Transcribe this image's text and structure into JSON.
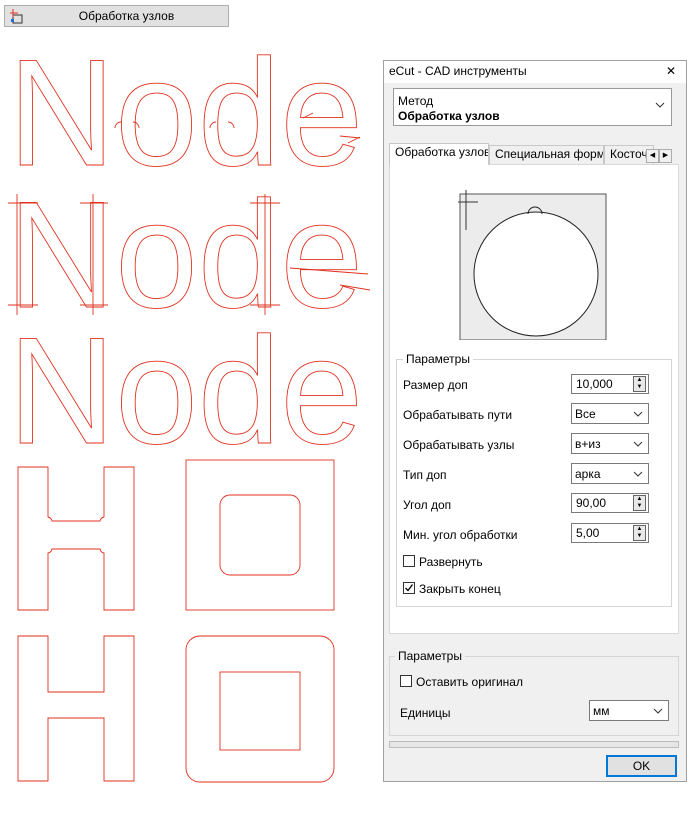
{
  "toolbar": {
    "button_label": "Обработка узлов",
    "button_icon": "node-tool-icon"
  },
  "canvas": {
    "word": "Node",
    "stroke_color": "#e0301e"
  },
  "panel": {
    "title": "eCut - CAD инструменты",
    "method_label": "Метод",
    "method_value": "Обработка узлов",
    "tabs": [
      "Обработка узлов",
      "Специальная форма",
      "Косточ"
    ],
    "params_title": "Параметры",
    "fields": {
      "size_label": "Размер доп",
      "size_value": "10,000",
      "paths_label": "Обрабатывать пути",
      "paths_value": "Все",
      "nodes_label": "Обрабатывать узлы",
      "nodes_value": "в+из",
      "type_label": "Тип доп",
      "type_value": "арка",
      "angle_label": "Угол доп",
      "angle_value": "90,00",
      "minangle_label": "Мин. угол обработки",
      "minangle_value": "5,00",
      "expand_label": "Развернуть",
      "expand_checked": false,
      "close_label": "Закрыть конец",
      "close_checked": true
    },
    "params2_title": "Параметры",
    "keep_original_label": "Оставить оригинал",
    "keep_original_checked": false,
    "units_label": "Единицы",
    "units_value": "мм",
    "ok_label": "OK"
  }
}
